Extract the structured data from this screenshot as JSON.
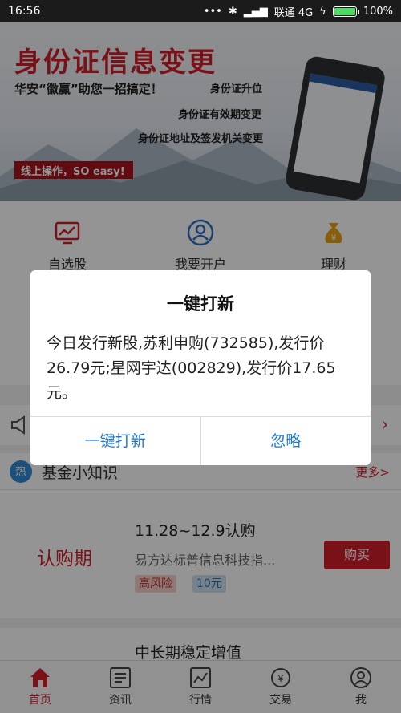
{
  "status_bar": {
    "time": "16:56",
    "carrier": "联通 4G",
    "battery": "100%",
    "battery_color": "#4cd964"
  },
  "banner": {
    "title": "身份证信息变更",
    "subtitle": "华安“徽赢”助您一招搞定！",
    "tags": [
      "身份证升位",
      "身份证有效期变更",
      "身份证地址及签发机关变更"
    ],
    "online_text": "线上操作，SO easy!"
  },
  "quick_icons": [
    {
      "icon": "monitor-chart-icon",
      "label": "自选股"
    },
    {
      "icon": "user-circle-icon",
      "label": "我要开户"
    },
    {
      "icon": "money-bag-icon",
      "label": "理财"
    }
  ],
  "notice": {
    "icon": "speaker-icon",
    "arrow": "›"
  },
  "fund_section": {
    "badge": "热",
    "title": "基金小知识",
    "more": "更多>",
    "item": {
      "period_label": "认购期",
      "dates": "11.28~12.9认购",
      "name": "易方达标普信息科技指...",
      "buy_label": "购买",
      "risk_tag": "高风险",
      "min_tag": "10元"
    },
    "next_title": "中长期稳定增值"
  },
  "tabbar": [
    {
      "icon": "home-icon",
      "label": "首页",
      "active": true
    },
    {
      "icon": "news-icon",
      "label": "资讯",
      "active": false
    },
    {
      "icon": "chart-icon",
      "label": "行情",
      "active": false
    },
    {
      "icon": "exchange-icon",
      "label": "交易",
      "active": false
    },
    {
      "icon": "profile-icon",
      "label": "我",
      "active": false
    }
  ],
  "dialog": {
    "title": "一键打新",
    "message": "今日发行新股,苏利申购(732585),发行价26.79元;星网宇达(002829),发行价17.65元。",
    "confirm_label": "一键打新",
    "ignore_label": "忽略"
  },
  "colors": {
    "brand_red": "#d0202a",
    "link_blue": "#2277cc"
  }
}
